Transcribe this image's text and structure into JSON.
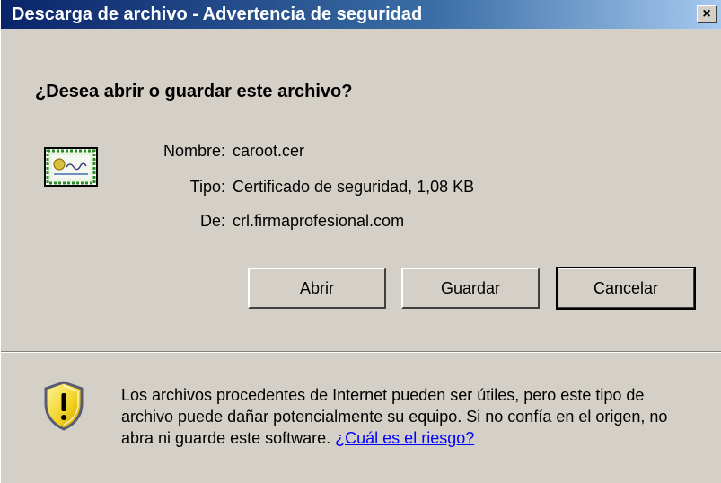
{
  "window": {
    "title": "Descarga de archivo - Advertencia de seguridad",
    "close_glyph": "×"
  },
  "prompt": {
    "question": "¿Desea abrir o guardar este archivo?"
  },
  "file": {
    "icon": "certificate-icon",
    "name_label": "Nombre:",
    "name_value": "caroot.cer",
    "type_label": "Tipo:",
    "type_value": "Certificado de seguridad, 1,08 KB",
    "from_label": "De:",
    "from_value": "crl.firmaprofesional.com"
  },
  "buttons": {
    "open": "Abrir",
    "save": "Guardar",
    "cancel": "Cancelar"
  },
  "warning": {
    "icon": "security-shield-icon",
    "text": "Los archivos procedentes de Internet pueden ser útiles, pero este tipo de archivo puede dañar potencialmente su equipo. Si no confía en el origen, no abra ni guarde este software.",
    "link": "¿Cuál es el riesgo?"
  },
  "colors": {
    "dialog_background": "#d4d0c8",
    "titlebar_start": "#0a246a",
    "titlebar_end": "#a6caf0",
    "link": "#0000ff"
  }
}
